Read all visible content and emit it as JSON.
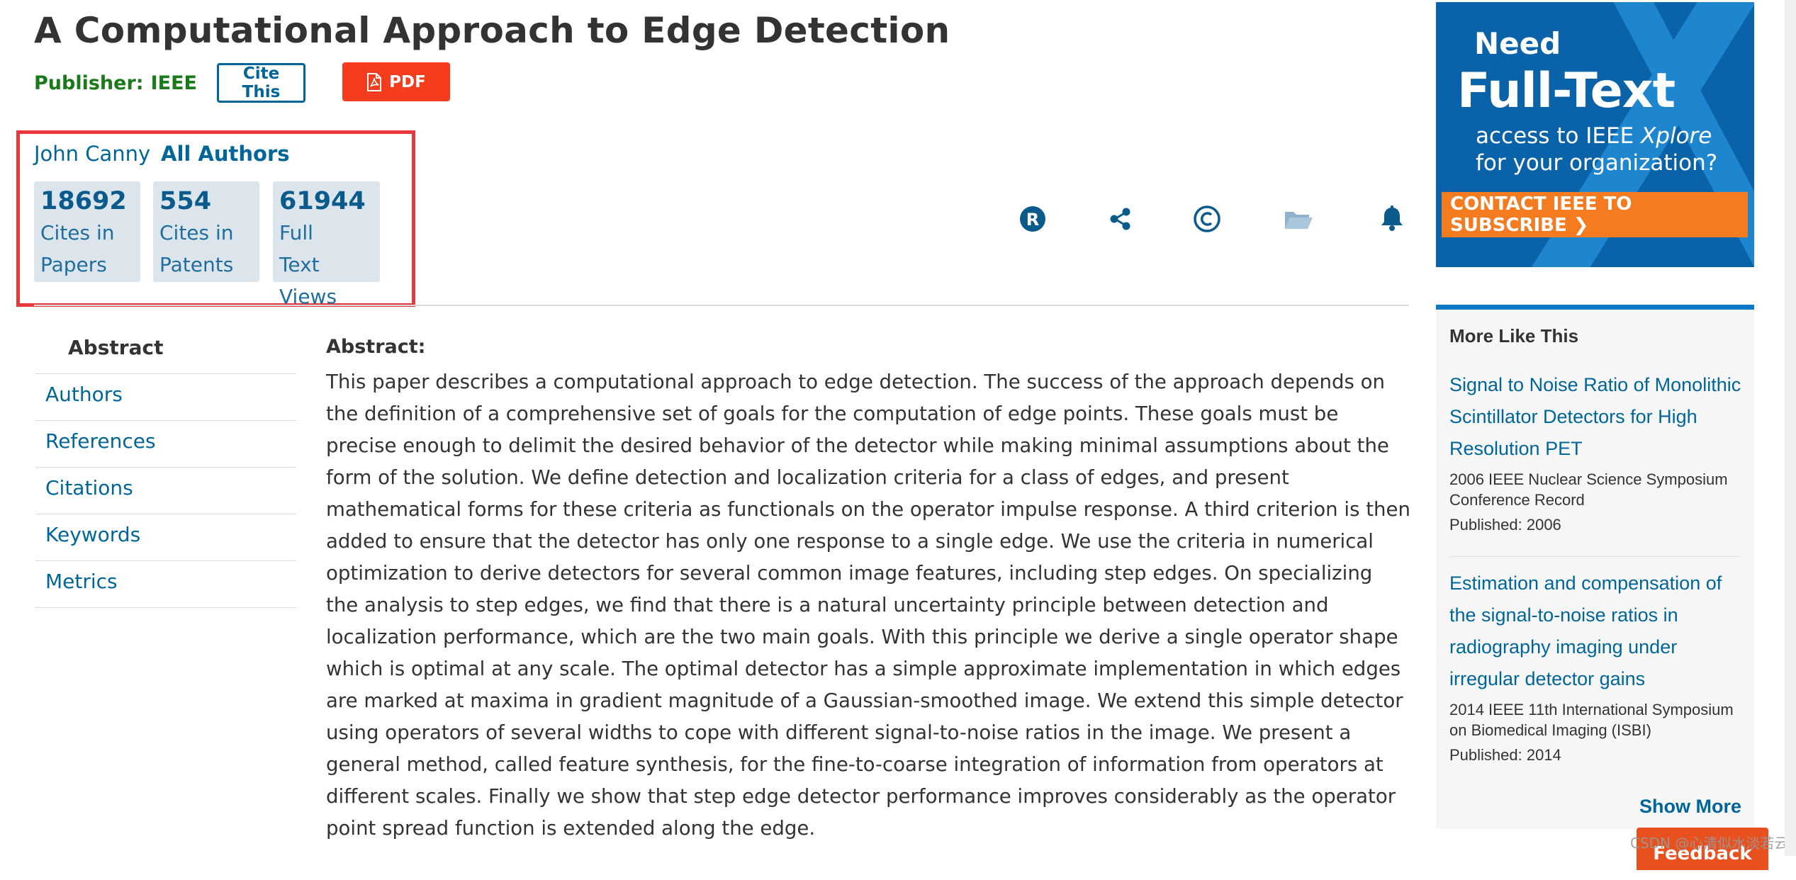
{
  "article": {
    "title": "A Computational Approach to Edge Detection",
    "publisher_label": "Publisher:",
    "publisher_name": "IEEE",
    "cite_label": "Cite This",
    "pdf_label": "PDF"
  },
  "authors": {
    "name": "John Canny",
    "all_label": "All Authors"
  },
  "metrics": [
    {
      "value": "18692",
      "line1": "Cites in",
      "line2": "Papers",
      "line3": ""
    },
    {
      "value": "554",
      "line1": "Cites in",
      "line2": "Patents",
      "line3": ""
    },
    {
      "value": "61944",
      "line1": "Full",
      "line2": "Text",
      "line3": "Views"
    }
  ],
  "icons": [
    "rights-icon",
    "share-icon",
    "copyright-icon",
    "folder-icon",
    "alert-bell-icon"
  ],
  "colors": {
    "accent": "#006699",
    "pdf": "#f53d1e",
    "highlight_box": "#e8383b",
    "publisher": "#1a7a1a"
  },
  "nav": {
    "items": [
      "Abstract",
      "Authors",
      "References",
      "Citations",
      "Keywords",
      "Metrics"
    ]
  },
  "abstract": {
    "heading": "Abstract:",
    "text": "This paper describes a computational approach to edge detection. The success of the approach depends on the definition of a comprehensive set of goals for the computation of edge points. These goals must be precise enough to delimit the desired behavior of the detector while making minimal assumptions about the form of the solution. We define detection and localization criteria for a class of edges, and present mathematical forms for these criteria as functionals on the operator impulse response. A third criterion is then added to ensure that the detector has only one response to a single edge. We use the criteria in numerical optimization to derive detectors for several common image features, including step edges. On specializing the analysis to step edges, we find that there is a natural uncertainty principle between detection and localization performance, which are the two main goals. With this principle we derive a single operator shape which is optimal at any scale. The optimal detector has a simple approximate implementation in which edges are marked at maxima in gradient magnitude of a Gaussian-smoothed image. We extend this simple detector using operators of several widths to cope with different signal-to-noise ratios in the image. We present a general method, called feature synthesis, for the fine-to-coarse integration of information from operators at different scales. Finally we show that step edge detector performance improves considerably as the operator point spread function is extended along the edge."
  },
  "ad": {
    "need": "Need",
    "full_text": "Full-Text",
    "access_prefix": "access to IEEE",
    "access_brand": "Xplore",
    "access_suffix": "for your organization?",
    "cta": "CONTACT IEEE TO SUBSCRIBE ❯"
  },
  "more_like_this": {
    "title": "More Like This",
    "items": [
      {
        "title": "Signal to Noise Ratio of Monolithic Scintillator Detectors for High Resolution PET",
        "venue": "2006 IEEE Nuclear Science Symposium Conference Record",
        "published": "Published: 2006"
      },
      {
        "title": "Estimation and compensation of the signal-to-noise ratios in radiography imaging under irregular detector gains",
        "venue": "2014 IEEE 11th International Symposium on Biomedical Imaging (ISBI)",
        "published": "Published: 2014"
      }
    ],
    "show_more": "Show More"
  },
  "feedback": "Feedback",
  "watermark": "CSDN @心清似水淡若云"
}
